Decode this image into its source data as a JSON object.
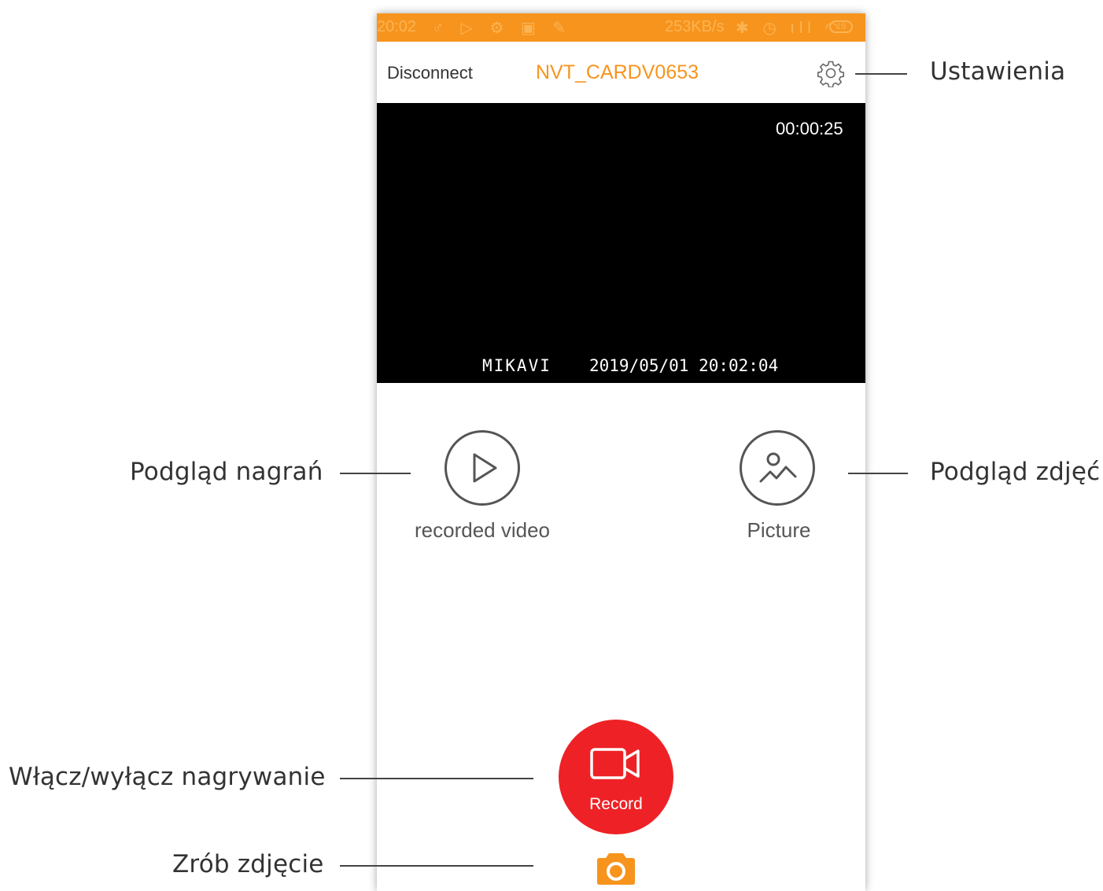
{
  "status_bar": {
    "time": "20:02",
    "speed": "253KB/s",
    "battery": "19",
    "background_color": "#f7941d"
  },
  "header": {
    "disconnect_label": "Disconnect",
    "device_name": "NVT_CARDV0653",
    "settings_icon": "gear-icon",
    "accent_color": "#f7941d"
  },
  "video": {
    "recording_time": "00:00:25",
    "osd_brand": "MIKAVI",
    "osd_datetime": "2019/05/01 20:02:04"
  },
  "actions": {
    "recorded_video_label": "recorded video",
    "recorded_video_icon": "play-icon",
    "picture_label": "Picture",
    "picture_icon": "image-icon",
    "record_label": "Record",
    "record_icon": "video-camera-icon",
    "record_color": "#ee2226",
    "snapshot_icon": "camera-icon"
  },
  "callouts": {
    "settings": "Ustawienia",
    "recorded_video": "Podgląd nagrań",
    "pictures": "Podgląd zdjęć",
    "record_toggle": "Włącz/wyłącz nagrywanie",
    "take_photo": "Zrób zdjęcie"
  }
}
